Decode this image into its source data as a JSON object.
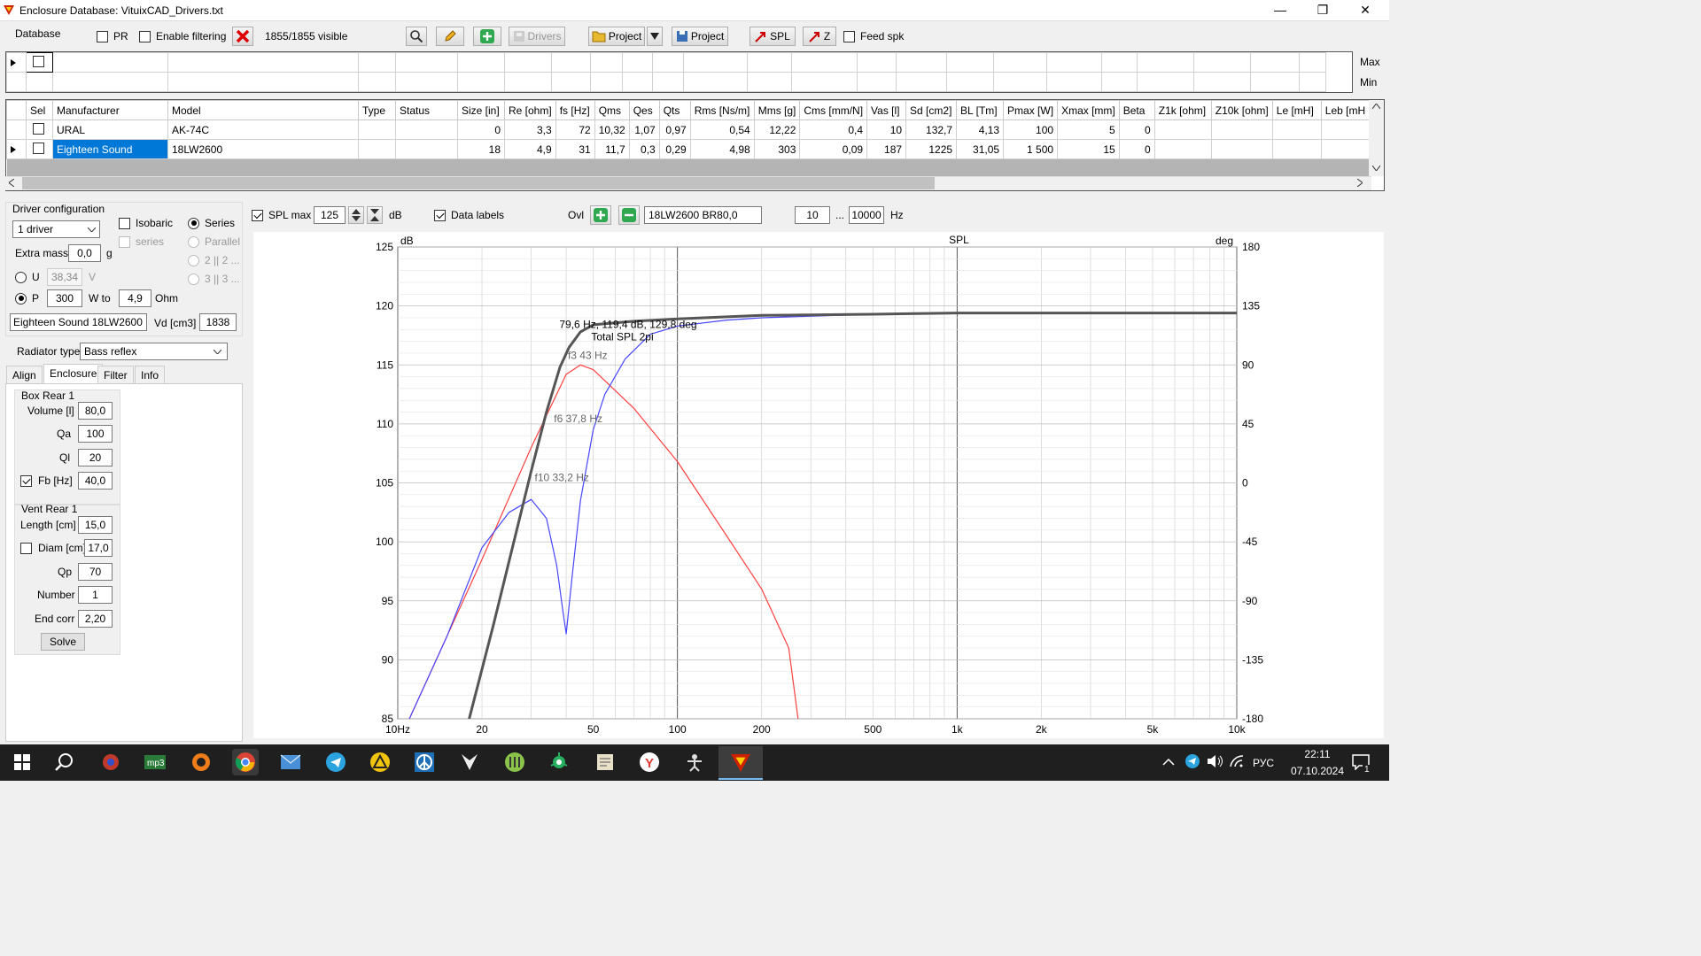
{
  "window": {
    "title": "Enclosure  Database: VituixCAD_Drivers.txt",
    "btn_min": "—",
    "btn_restore": "❐",
    "btn_close": "✕"
  },
  "toolbar": {
    "database_label": "Database",
    "pr_label": "PR",
    "enable_filtering_label": "Enable filtering",
    "visible_count": "1855/1855 visible",
    "drivers_btn": "Drivers",
    "project_btn1": "Project",
    "project_btn2": "Project",
    "spl_btn": "SPL",
    "z_btn": "Z",
    "feed_spk_label": "Feed spk"
  },
  "filter": {
    "max_label": "Max",
    "min_label": "Min"
  },
  "grid": {
    "columns": [
      "Sel",
      "Manufacturer",
      "Model",
      "Type",
      "Status",
      "Size [in]",
      "Re [ohm]",
      "fs [Hz]",
      "Qms",
      "Qes",
      "Qts",
      "Rms [Ns/m]",
      "Mms [g]",
      "Cms [mm/N]",
      "Vas [l]",
      "Sd [cm2]",
      "BL [Tm]",
      "Pmax [W]",
      "Xmax [mm]",
      "Beta",
      "Z1k [ohm]",
      "Z10k [ohm]",
      "Le [mH]",
      "Leb [mH"
    ],
    "rows": [
      [
        "",
        "URAL",
        "AK-74C",
        "",
        "",
        "0",
        "3,3",
        "72",
        "10,32",
        "1,07",
        "0,97",
        "0,54",
        "12,22",
        "0,4",
        "10",
        "132,7",
        "4,13",
        "100",
        "5",
        "0",
        "",
        "",
        "",
        ""
      ],
      [
        "",
        "Eighteen Sound",
        "18LW2600",
        "",
        "",
        "18",
        "4,9",
        "31",
        "11,7",
        "0,3",
        "0,29",
        "4,98",
        "303",
        "0,09",
        "187",
        "1225",
        "31,05",
        "1 500",
        "15",
        "0",
        "",
        "",
        "",
        ""
      ]
    ]
  },
  "driver_config": {
    "title": "Driver configuration",
    "drivers_select": "1 driver",
    "isobaric_label": "Isobaric",
    "series_sub_label": "series",
    "series_label": "Series",
    "parallel_label": "Parallel",
    "opt_2x2": "2 || 2 ...",
    "opt_3x3": "3 || 3 ...",
    "extra_mass_label": "Extra mass",
    "extra_mass_value": "0,0",
    "extra_mass_unit": "g",
    "u_label": "U",
    "u_value": "38,34",
    "u_unit": "V",
    "p_label": "P",
    "p_value": "300",
    "w_to_label": "W to",
    "ohm_value": "4,9",
    "ohm_unit": "Ohm",
    "driver_name": "Eighteen Sound 18LW2600",
    "vd_label": "Vd [cm3]",
    "vd_value": "1838",
    "radiator_type_label": "Radiator type",
    "radiator_type_value": "Bass reflex"
  },
  "tabs": [
    "Align",
    "Enclosure",
    "Filter",
    "Info"
  ],
  "box": {
    "title": "Box Rear 1",
    "volume_label": "Volume [l]",
    "volume_value": "80,0",
    "qa_label": "Qa",
    "qa_value": "100",
    "ql_label": "Ql",
    "ql_value": "20",
    "fb_label": "Fb [Hz]",
    "fb_value": "40,0"
  },
  "vent": {
    "title": "Vent Rear 1",
    "length_label": "Length [cm]",
    "length_value": "15,0",
    "diam_label": "Diam [cm]",
    "diam_value": "17,0",
    "qp_label": "Qp",
    "qp_value": "70",
    "number_label": "Number",
    "number_value": "1",
    "endcorr_label": "End corr",
    "endcorr_value": "2,20",
    "solve_btn": "Solve"
  },
  "chart_toolbar": {
    "spl_max_label": "SPL max",
    "spl_max_value": "125",
    "db_unit": "dB",
    "data_labels_label": "Data labels",
    "ovl_label": "Ovl",
    "overlay_name": "18LW2600 BR80,0",
    "f_min": "10",
    "dots": "...",
    "f_max": "10000",
    "hz_unit": "Hz"
  },
  "chart_data": {
    "type": "line",
    "title": "SPL",
    "ylabel_left": "dB",
    "ylabel_right": "deg",
    "x_scale": "log",
    "xlim": [
      10,
      10000
    ],
    "ylim": [
      85,
      125
    ],
    "y2lim": [
      -180,
      180
    ],
    "x_ticks": [
      {
        "v": 10,
        "l": "10Hz"
      },
      {
        "v": 20,
        "l": "20"
      },
      {
        "v": 50,
        "l": "50"
      },
      {
        "v": 100,
        "l": "100"
      },
      {
        "v": 200,
        "l": "200"
      },
      {
        "v": 500,
        "l": "500"
      },
      {
        "v": 1000,
        "l": "1k"
      },
      {
        "v": 2000,
        "l": "2k"
      },
      {
        "v": 5000,
        "l": "5k"
      },
      {
        "v": 10000,
        "l": "10k"
      }
    ],
    "y_ticks": [
      125,
      120,
      115,
      110,
      105,
      100,
      95,
      90,
      85
    ],
    "y2_ticks": [
      180,
      135,
      90,
      45,
      0,
      -45,
      -90,
      -135,
      -180
    ],
    "grid": true,
    "series": [
      {
        "color": "#ff4040",
        "width": 1.2,
        "points": [
          [
            11,
            85
          ],
          [
            20,
            98.5
          ],
          [
            30,
            108
          ],
          [
            40,
            114.2
          ],
          [
            45,
            115
          ],
          [
            50,
            114.6
          ],
          [
            70,
            111.3
          ],
          [
            100,
            106.8
          ],
          [
            150,
            100.5
          ],
          [
            200,
            96
          ],
          [
            250,
            91
          ],
          [
            270,
            85
          ]
        ]
      },
      {
        "color": "#4646ff",
        "width": 1.2,
        "points": [
          [
            11,
            85
          ],
          [
            15,
            92
          ],
          [
            20,
            99.5
          ],
          [
            25,
            102.5
          ],
          [
            30,
            103.6
          ],
          [
            34,
            102
          ],
          [
            37,
            98
          ],
          [
            39,
            94
          ],
          [
            40,
            92.2
          ],
          [
            42,
            97
          ],
          [
            45,
            103.5
          ],
          [
            50,
            109.5
          ],
          [
            55,
            112.5
          ],
          [
            65,
            115.5
          ],
          [
            80,
            117.6
          ],
          [
            100,
            118.3
          ],
          [
            150,
            118.8
          ],
          [
            200,
            119
          ],
          [
            500,
            119.3
          ],
          [
            1000,
            119.4
          ],
          [
            10000,
            119.4
          ]
        ]
      },
      {
        "color": "#555555",
        "width": 3,
        "points": [
          [
            18,
            85
          ],
          [
            22,
            93
          ],
          [
            26,
            100
          ],
          [
            30,
            106
          ],
          [
            34,
            111
          ],
          [
            38,
            114.8
          ],
          [
            41,
            116.5
          ],
          [
            45,
            117.8
          ],
          [
            50,
            118.4
          ],
          [
            70,
            118.7
          ],
          [
            100,
            118.9
          ],
          [
            200,
            119.2
          ],
          [
            500,
            119.3
          ],
          [
            1000,
            119.4
          ],
          [
            10000,
            119.4
          ]
        ]
      }
    ],
    "data_labels": [
      {
        "x": 79.6,
        "y": 119.4,
        "text": "79,6 Hz, 119,4 dB, 129,8 deg",
        "dx": -102,
        "dy": 17,
        "color": "#000"
      },
      {
        "x": 79.6,
        "y": 119.4,
        "text": "Total SPL 2pi",
        "dx": -66,
        "dy": 31,
        "color": "#000"
      },
      {
        "x": 43,
        "y": 115,
        "text": "f3 43 Hz",
        "dx": -8,
        "dy": -7,
        "color": "#666"
      },
      {
        "x": 37.8,
        "y": 110,
        "text": "f6 37,8 Hz",
        "dx": -6,
        "dy": -2,
        "color": "#666"
      },
      {
        "x": 33.2,
        "y": 105,
        "text": "f10 33,2 Hz",
        "dx": -10,
        "dy": -2,
        "color": "#666"
      }
    ]
  },
  "taskbar": {
    "lang": "РУС",
    "time": "22:11",
    "date": "07.10.2024",
    "notif_count": "1"
  }
}
